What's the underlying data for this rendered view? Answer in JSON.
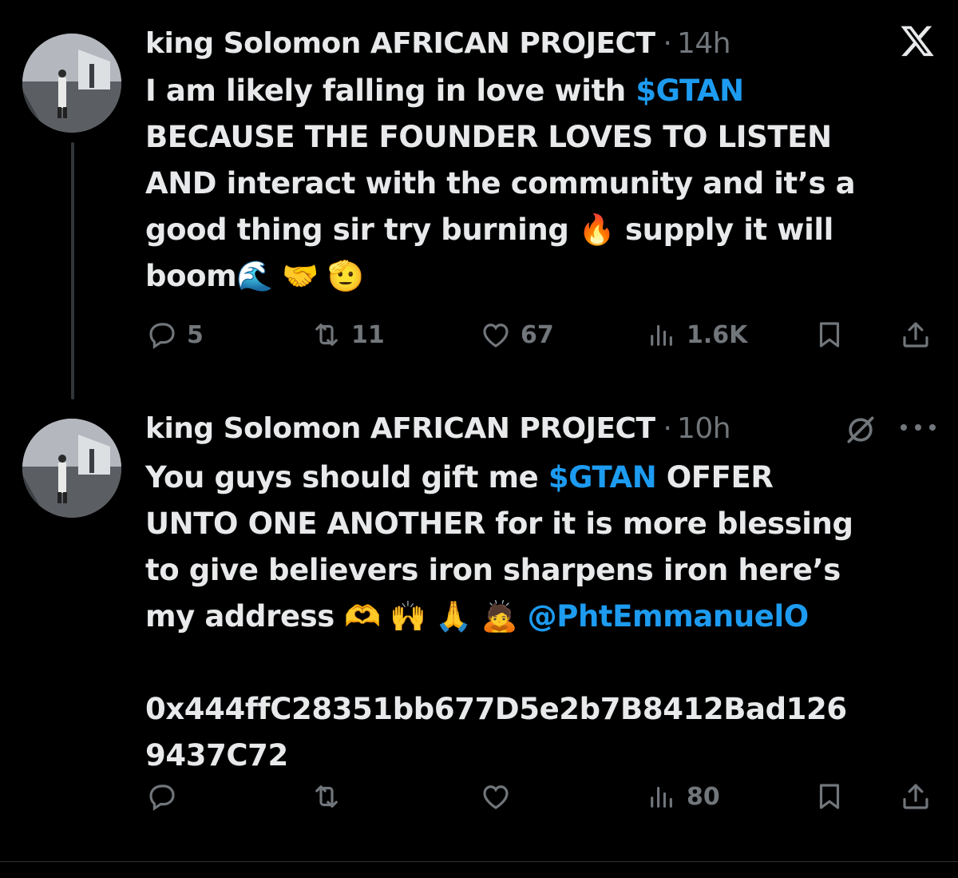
{
  "tweets": [
    {
      "author": "king Solomon AFRICAN PROJECT",
      "separator": "·",
      "time": "14h",
      "lines": [
        [
          "I am likely falling in love with ",
          "$GTAN"
        ],
        [
          "BECAUSE THE FOUNDER LOVES TO LISTEN"
        ],
        [
          "AND  interact with the community and it’s a"
        ],
        [
          "good thing sir try burning ",
          "🔥",
          "  supply it will"
        ],
        [
          "boom",
          "🌊 🤝 🫡"
        ]
      ],
      "counts": {
        "replies": "5",
        "reposts": "11",
        "likes": "67",
        "views": "1.6K"
      }
    },
    {
      "author": "king Solomon AFRICAN PROJECT",
      "separator": "·",
      "time": "10h",
      "lines": [
        [
          "You guys should gift me ",
          "$GTAN",
          " OFFER"
        ],
        [
          "UNTO ONE ANOTHER for it is more blessing"
        ],
        [
          "to give  believers iron sharpens iron here’s"
        ],
        [
          "my address  ",
          "🫶 🙌 🙏 🙇",
          " ",
          "@PhtEmmanuelO"
        ],
        [
          ""
        ],
        [
          "0x444ffC28351bb677D5e2b7B8412Bad126"
        ],
        [
          "9437C72"
        ]
      ],
      "counts": {
        "replies": "",
        "reposts": "",
        "likes": "",
        "views": "80"
      }
    }
  ],
  "colors": {
    "background": "#000000",
    "text": "#e7e9ea",
    "muted": "#71767b",
    "link": "#1d9bf0",
    "thread_line": "#333639"
  },
  "icons": [
    "x-logo-icon",
    "grok-icon",
    "more-icon",
    "reply-icon",
    "repost-icon",
    "like-icon",
    "views-icon",
    "bookmark-icon",
    "share-icon"
  ]
}
